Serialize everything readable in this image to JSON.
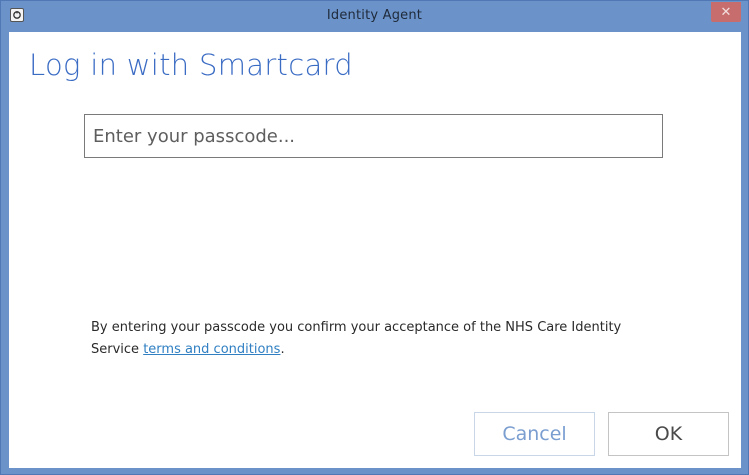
{
  "window": {
    "title": "Identity Agent",
    "close_glyph": "✕"
  },
  "main": {
    "heading": "Log in with Smartcard",
    "passcode": {
      "placeholder": "Enter your passcode...",
      "value": ""
    },
    "terms": {
      "text_before": "By entering your passcode you confirm your acceptance of the NHS Care Identity Service ",
      "link_text": "terms and conditions",
      "text_after": "."
    }
  },
  "buttons": {
    "cancel_label": "Cancel",
    "ok_label": "OK"
  },
  "colors": {
    "frame": "#6b93c9",
    "heading": "#3b6cc4",
    "link": "#2f7fc2",
    "close_button": "#c76d6d"
  },
  "icons": {
    "app": "identity-agent-icon",
    "close": "close-icon"
  }
}
